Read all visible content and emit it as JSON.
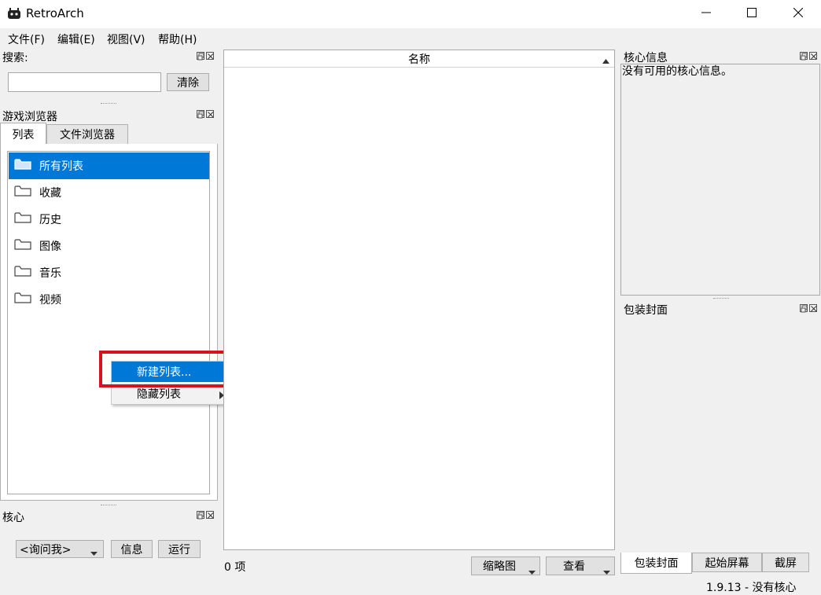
{
  "window": {
    "title": "RetroArch",
    "minimize_label": "—",
    "maximize_label": "☐",
    "close_label": "✕"
  },
  "menubar": {
    "items": [
      "文件(F)",
      "编辑(E)",
      "视图(V)",
      "帮助(H)"
    ]
  },
  "search_dock": {
    "title": "搜索:",
    "input_value": "",
    "clear_label": "清除"
  },
  "browser_dock": {
    "title": "游戏浏览器",
    "tabs": [
      "列表",
      "文件浏览器"
    ],
    "active_tab": 0,
    "items": [
      "所有列表",
      "收藏",
      "历史",
      "图像",
      "音乐",
      "视频"
    ],
    "selected_item": 0
  },
  "context_menu": {
    "items": [
      "新建列表...",
      "隐藏列表"
    ],
    "highlighted": 0,
    "highlight_color": "#d4131c"
  },
  "core_dock": {
    "title": "核心",
    "select_value": "<询问我>",
    "info_label": "信息",
    "run_label": "运行"
  },
  "table": {
    "column_header": "名称",
    "count_text": "0 项",
    "thumbnail_select": "缩略图",
    "view_select": "查看"
  },
  "core_info_dock": {
    "title": "核心信息",
    "text": "没有可用的核心信息。"
  },
  "cover_dock": {
    "title": "包装封面",
    "tabs": [
      "包装封面",
      "起始屏幕",
      "截屏"
    ],
    "active_tab": 0
  },
  "status_bar": {
    "text": "1.9.13 - 没有核心"
  },
  "colors": {
    "selection": "#0078d7",
    "menu_highlight": "#0078d7",
    "window_bg": "#f0f0f0"
  }
}
